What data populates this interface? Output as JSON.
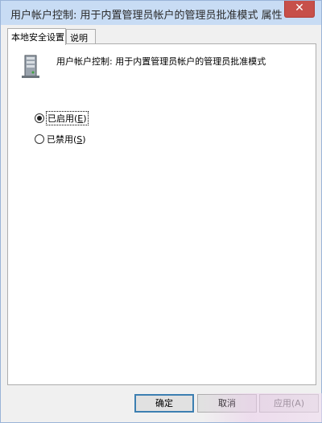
{
  "window": {
    "title": "用户帐户控制: 用于内置管理员帐户的管理员批准模式 属性",
    "close_glyph": "✕"
  },
  "tabs": [
    {
      "label": "本地安全设置",
      "active": true
    },
    {
      "label": "说明",
      "active": false
    }
  ],
  "policy": {
    "icon": "server-icon",
    "title": "用户帐户控制: 用于内置管理员帐户的管理员批准模式"
  },
  "options": [
    {
      "label": "已启用",
      "hotkey": "E",
      "checked": true
    },
    {
      "label": "已禁用",
      "hotkey": "S",
      "checked": false
    }
  ],
  "buttons": {
    "ok": "确定",
    "cancel": "取消",
    "apply": "应用(A)"
  }
}
